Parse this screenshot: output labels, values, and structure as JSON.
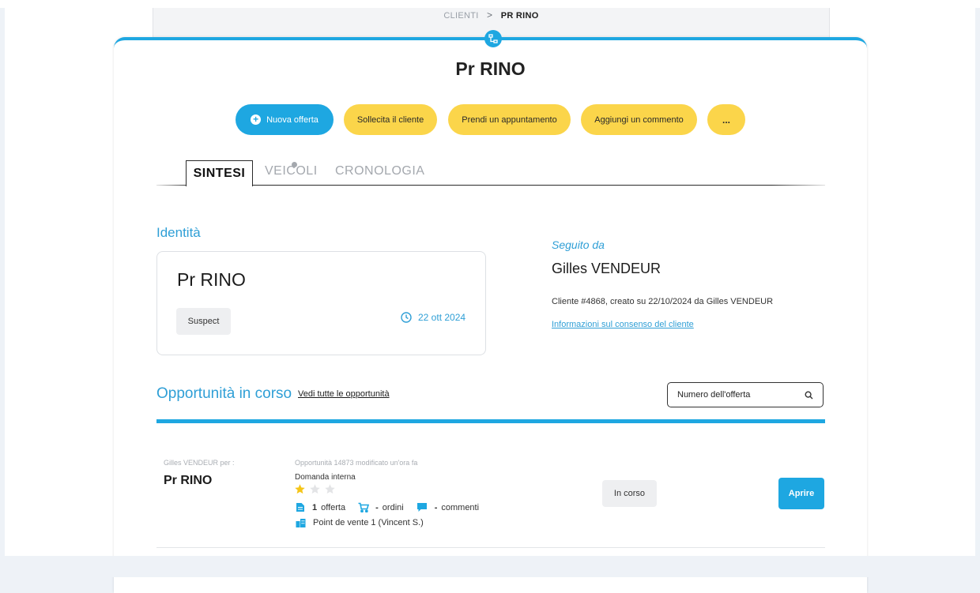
{
  "breadcrumb": {
    "parent": "CLIENTI",
    "separator": ">",
    "current": "PR RINO"
  },
  "page_title": "Pr RINO",
  "actions": {
    "new_offer": "Nuova offerta",
    "solicit": "Sollecita il cliente",
    "appointment": "Prendi un appuntamento",
    "comment": "Aggiungi un commento",
    "more": "..."
  },
  "tabs": [
    {
      "label": "SINTESI",
      "active": true
    },
    {
      "label": "VEICOLI",
      "active": false
    },
    {
      "label": "CRONOLOGIA",
      "active": false
    }
  ],
  "identity": {
    "section_title": "Identità",
    "name": "Pr RINO",
    "tag": "Suspect",
    "date": "22 ott 2024"
  },
  "followed": {
    "label": "Seguito da",
    "name": "Gilles VENDEUR",
    "info": "Cliente #4868, creato su 22/10/2024 da Gilles VENDEUR",
    "consent_link": "Informazioni sul consenso del cliente"
  },
  "opportunities": {
    "section_title": "Opportunità in corso",
    "all_link": "Vedi tutte le opportunità",
    "search_placeholder": "Numero dell'offerta",
    "rows": [
      {
        "by": "Gilles VENDEUR per :",
        "client": "Pr RINO",
        "opp_info": "Opportunità 14873 modificato un'ora fa",
        "type": "Domanda interna",
        "rating": 1,
        "rating_max": 3,
        "offers_count": "1",
        "offers_label": "offerta",
        "orders_count": "-",
        "orders_label": "ordini",
        "comments_count": "-",
        "comments_label": "commenti",
        "point_of_sale": "Point de vente 1 (Vincent S.)",
        "status": "In corso",
        "open_label": "Aprire"
      }
    ]
  },
  "colors": {
    "accent": "#1ea7e1",
    "yellow": "#fbd54a",
    "section_title": "#2f9fd6",
    "star_on": "#f5c518",
    "star_off": "#e3e4e6"
  },
  "icons": [
    "hierarchy-icon",
    "plus-icon",
    "clock-icon",
    "search-icon",
    "star-icon",
    "document-icon",
    "cart-icon",
    "chat-icon",
    "building-icon"
  ]
}
